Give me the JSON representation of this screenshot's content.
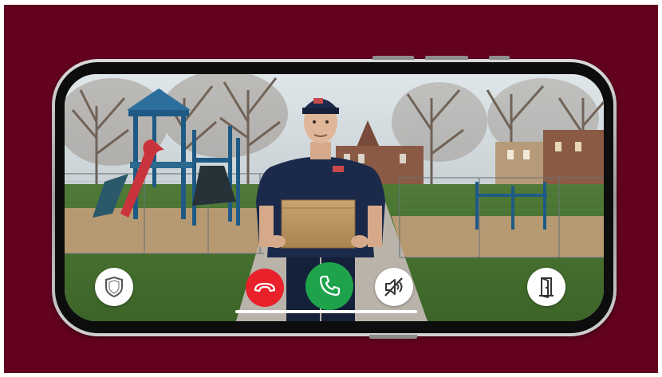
{
  "app": {
    "screen": "incoming-video-doorbell-call"
  },
  "call_controls": {
    "items": [
      {
        "name": "shield-button",
        "icon": "shield-icon",
        "color": "#ffffff"
      },
      {
        "name": "decline-button",
        "icon": "phone-hangup-icon",
        "color": "#e8212b"
      },
      {
        "name": "answer-button",
        "icon": "phone-icon",
        "color": "#1ea34b"
      },
      {
        "name": "mute-button",
        "icon": "speaker-muted-icon",
        "color": "#ffffff"
      },
      {
        "name": "open-door-button",
        "icon": "door-open-icon",
        "color": "#ffffff"
      }
    ]
  },
  "colors": {
    "background": "#62021f",
    "decline": "#e8212b",
    "answer": "#1ea34b"
  }
}
